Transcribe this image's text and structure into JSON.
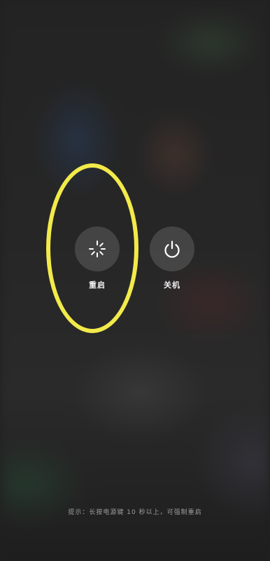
{
  "power_menu": {
    "restart": {
      "label": "重启",
      "icon": "restart-spinner-icon"
    },
    "shutdown": {
      "label": "关机",
      "icon": "power-icon"
    },
    "hint": "提示：长按电源键 10 秒以上，可强制重启"
  },
  "colors": {
    "highlight_ring": "#f2ea4a",
    "button_bg": "rgba(255,255,255,0.14)",
    "label_text": "#f2f2f2"
  }
}
